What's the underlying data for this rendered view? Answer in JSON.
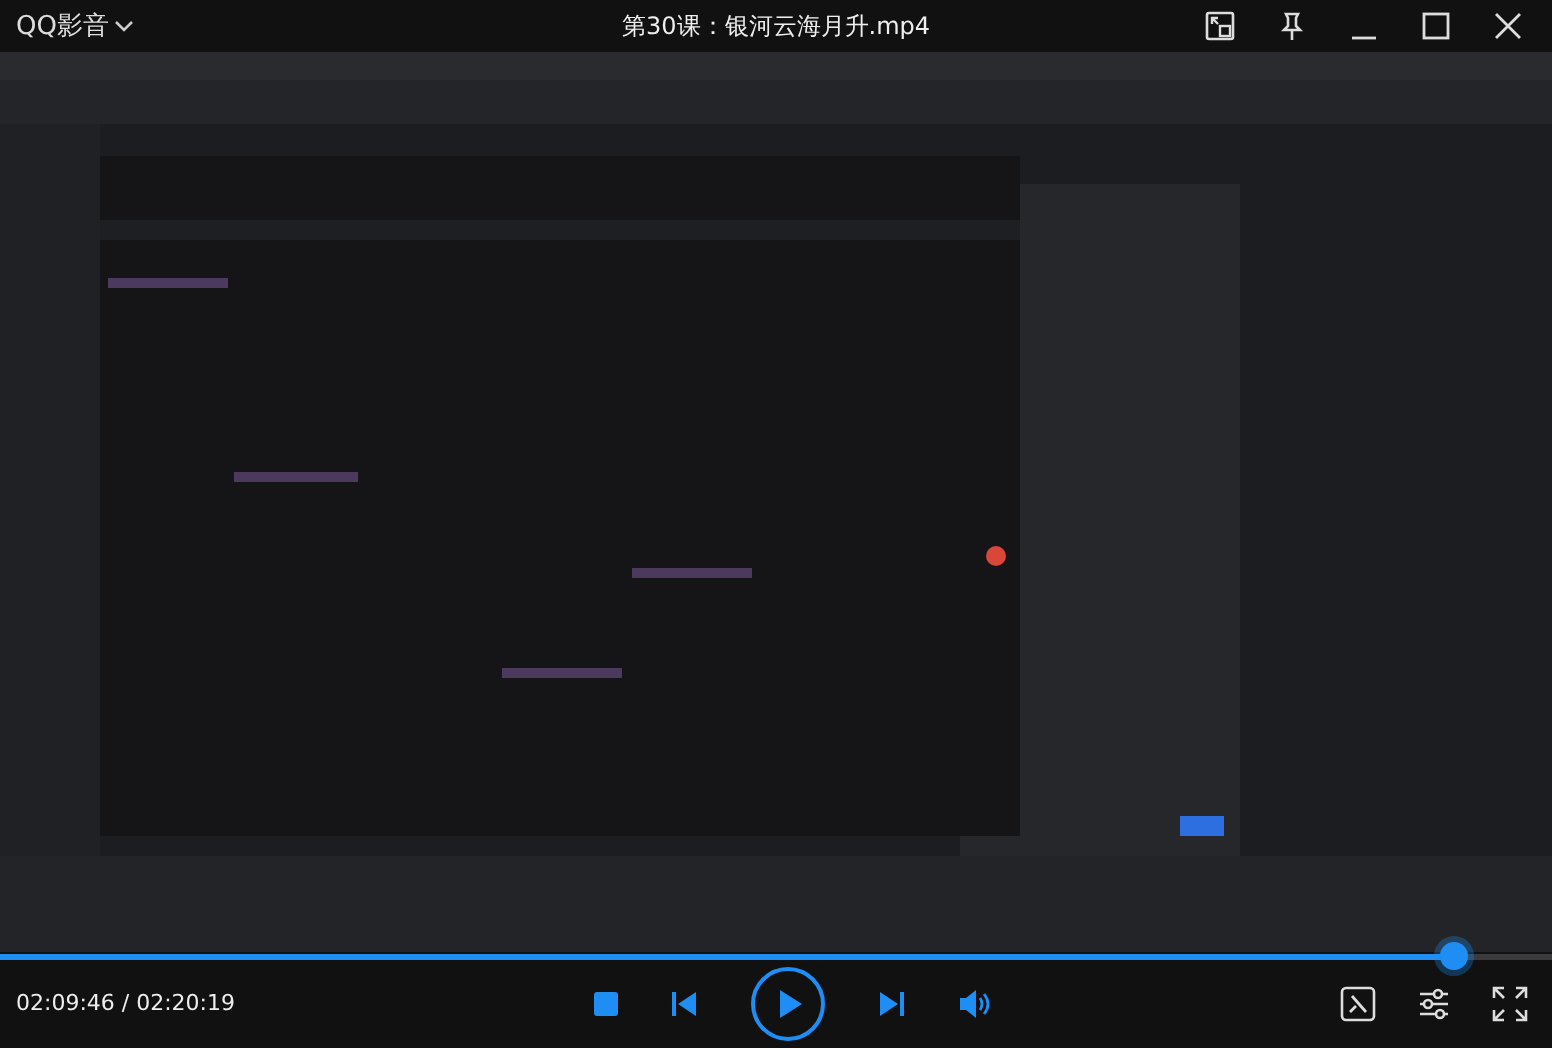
{
  "app": {
    "name": "QQ影音"
  },
  "window": {
    "title": "第30课：银河云海月升.mp4"
  },
  "playback": {
    "level": 0.937,
    "elapsed": "02:09:46",
    "separator": " / ",
    "duration": "02:20:19"
  }
}
